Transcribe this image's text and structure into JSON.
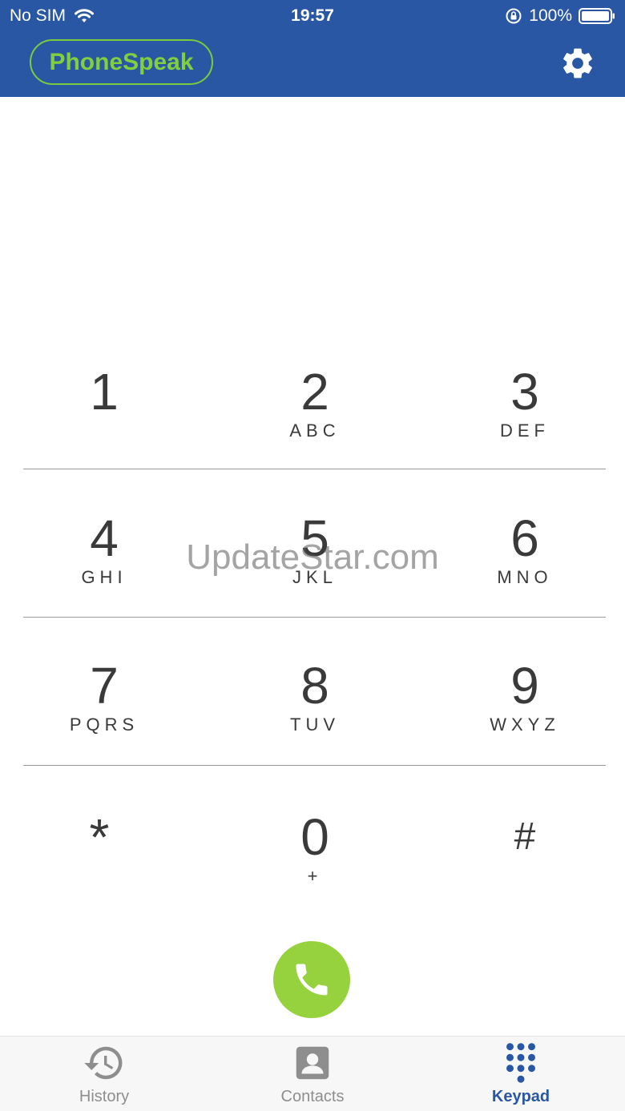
{
  "status_bar": {
    "carrier": "No SIM",
    "time": "19:57",
    "battery": "100%"
  },
  "header": {
    "brand": "PhoneSpeak",
    "settings_icon": "gear-icon"
  },
  "keypad": {
    "keys": [
      {
        "digit": "1",
        "letters": ""
      },
      {
        "digit": "2",
        "letters": "ABC"
      },
      {
        "digit": "3",
        "letters": "DEF"
      },
      {
        "digit": "4",
        "letters": "GHI"
      },
      {
        "digit": "5",
        "letters": "JKL"
      },
      {
        "digit": "6",
        "letters": "MNO"
      },
      {
        "digit": "7",
        "letters": "PQRS"
      },
      {
        "digit": "8",
        "letters": "TUV"
      },
      {
        "digit": "9",
        "letters": "WXYZ"
      },
      {
        "digit": "*",
        "letters": ""
      },
      {
        "digit": "0",
        "letters": "+"
      },
      {
        "digit": "#",
        "letters": ""
      }
    ]
  },
  "watermark": "UpdateStar.com",
  "call": {
    "icon": "phone-icon",
    "color": "#96d13e"
  },
  "tab_bar": {
    "tabs": [
      {
        "label": "History",
        "icon": "history-icon",
        "active": false
      },
      {
        "label": "Contacts",
        "icon": "contact-icon",
        "active": false
      },
      {
        "label": "Keypad",
        "icon": "keypad-icon",
        "active": true
      }
    ]
  },
  "colors": {
    "brand_blue": "#2957a4",
    "accent_green": "#82cf3e"
  }
}
